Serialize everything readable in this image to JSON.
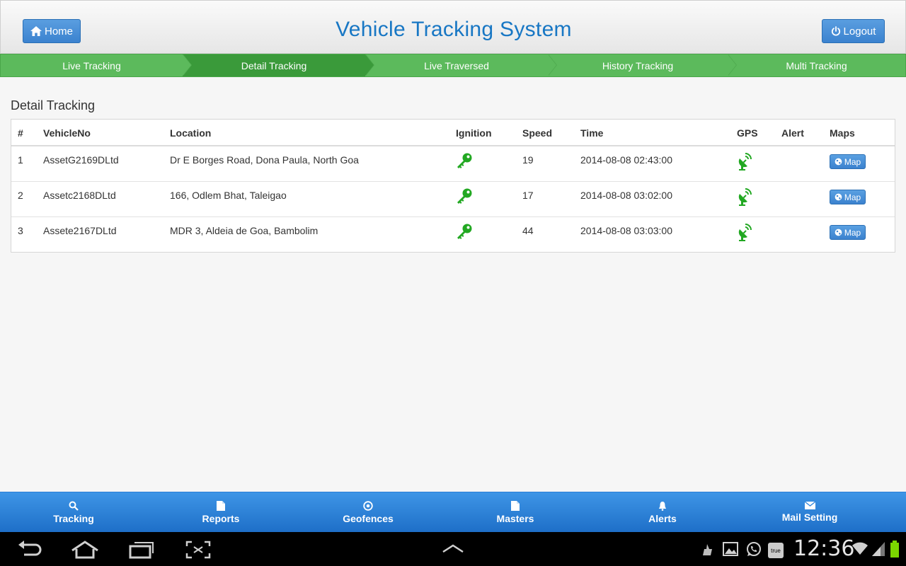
{
  "header": {
    "home_label": "Home",
    "title": "Vehicle Tracking System",
    "logout_label": "Logout"
  },
  "tabs": [
    {
      "label": "Live Tracking",
      "active": false
    },
    {
      "label": "Detail Tracking",
      "active": true
    },
    {
      "label": "Live Traversed",
      "active": false
    },
    {
      "label": "History Tracking",
      "active": false
    },
    {
      "label": "Multi Tracking",
      "active": false
    }
  ],
  "section_title": "Detail Tracking",
  "table": {
    "headers": {
      "num": "#",
      "vehicle": "VehicleNo",
      "location": "Location",
      "ignition": "Ignition",
      "speed": "Speed",
      "time": "Time",
      "gps": "GPS",
      "alert": "Alert",
      "maps": "Maps"
    },
    "rows": [
      {
        "num": "1",
        "vehicle": "AssetG2169DLtd",
        "location": "Dr E Borges Road, Dona Paula, North Goa",
        "ignition": "key-icon",
        "speed": "19",
        "time": "2014-08-08 02:43:00",
        "gps": "satellite-icon",
        "alert": "",
        "map_label": "Map"
      },
      {
        "num": "2",
        "vehicle": "Assetc2168DLtd",
        "location": "166, Odlem Bhat, Taleigao",
        "ignition": "key-icon",
        "speed": "17",
        "time": "2014-08-08 03:02:00",
        "gps": "satellite-icon",
        "alert": "",
        "map_label": "Map"
      },
      {
        "num": "3",
        "vehicle": "Assete2167DLtd",
        "location": "MDR 3, Aldeia de Goa, Bambolim",
        "ignition": "key-icon",
        "speed": "44",
        "time": "2014-08-08 03:03:00",
        "gps": "satellite-icon",
        "alert": "",
        "map_label": "Map"
      }
    ]
  },
  "bottom_nav": [
    {
      "label": "Tracking",
      "icon": "search-icon"
    },
    {
      "label": "Reports",
      "icon": "document-icon"
    },
    {
      "label": "Geofences",
      "icon": "target-icon"
    },
    {
      "label": "Masters",
      "icon": "document-icon"
    },
    {
      "label": "Alerts",
      "icon": "bell-icon"
    },
    {
      "label": "Mail Setting",
      "icon": "envelope-icon"
    }
  ],
  "system_bar": {
    "clock": "12:36",
    "carrier_badge": "true"
  },
  "colors": {
    "title_blue": "#1877c4",
    "tab_green": "#5cba5c",
    "tab_active_green": "#3a9a3a",
    "nav_blue": "#2f86dc",
    "icon_green": "#22a822"
  }
}
